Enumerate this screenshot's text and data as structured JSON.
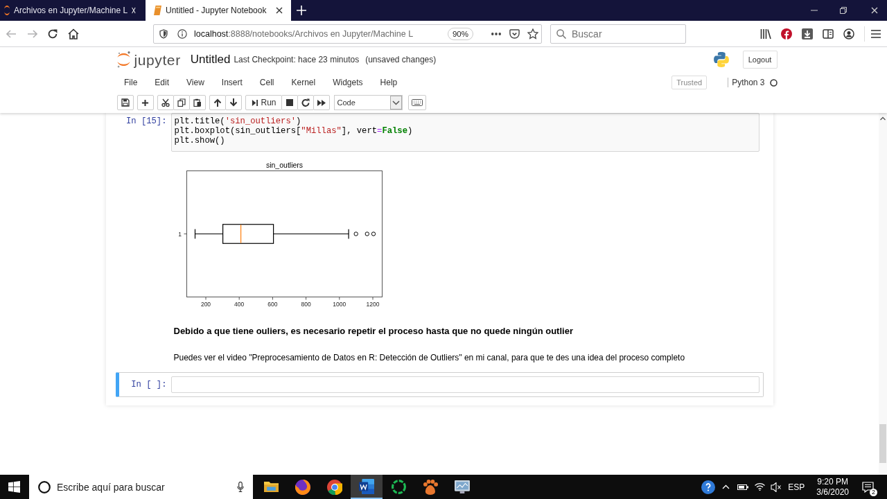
{
  "browser": {
    "tabs": [
      {
        "title": "Archivos en Jupyter/Machine L",
        "kind": "jupyter",
        "selected": false
      },
      {
        "title": "Untitled - Jupyter Notebook",
        "kind": "notebook",
        "selected": true
      }
    ],
    "back": {
      "disabled": true
    },
    "forward": {
      "disabled": true
    },
    "address": {
      "host": "localhost",
      "path": ":8888/notebooks/Archivos en Jupyter/Machine L"
    },
    "zoom": "90%",
    "search": {
      "placeholder": "Buscar"
    }
  },
  "notebook": {
    "logo": "jupyter",
    "name": "Untitled",
    "checkpoint": "Last Checkpoint: hace 23 minutos",
    "save_status": "(unsaved changes)",
    "logout": "Logout",
    "menu": [
      "File",
      "Edit",
      "View",
      "Insert",
      "Cell",
      "Kernel",
      "Widgets",
      "Help"
    ],
    "trusted": "Trusted",
    "kernel": "Python 3",
    "kernel_busy": false,
    "toolbar": {
      "run": "Run",
      "cell_type": "Code"
    }
  },
  "cells": [
    {
      "kind": "code",
      "selected": false,
      "prompt": "In [15]:",
      "lines": [
        [
          {
            "text": "plt.title(",
            "kind": "plain"
          },
          {
            "text": "'sin_outliers'",
            "kind": "string"
          },
          {
            "text": ")",
            "kind": "plain"
          }
        ],
        [
          {
            "text": "plt.boxplot(sin_outliers[",
            "kind": "plain"
          },
          {
            "text": "\"Millas\"",
            "kind": "string"
          },
          {
            "text": "], vert",
            "kind": "plain"
          },
          {
            "text": "=",
            "kind": "operator"
          },
          {
            "text": "False",
            "kind": "keyword"
          },
          {
            "text": ")",
            "kind": "plain"
          }
        ],
        [
          {
            "text": "plt.show()",
            "kind": "plain"
          }
        ]
      ],
      "output": {
        "figure": {
          "title": "sin_outliers",
          "x_tick_labels": [
            "200",
            "400",
            "600",
            "800",
            "1000",
            "1200"
          ],
          "y_tick_labels": [
            "1"
          ]
        }
      }
    },
    {
      "kind": "markdown",
      "selected": false,
      "paragraphs": [
        {
          "text": "Debido a que tiene ouliers, es necesario repetir el proceso hasta que no quede ningún outlier",
          "bold": true
        },
        {
          "text": "Puedes ver el video \"Preprocesamiento de Datos en R: Detección de Outliers\" en mi canal, para que te des una idea del proceso completo",
          "bold": false
        }
      ]
    },
    {
      "kind": "code",
      "selected": true,
      "prompt": "In [ ]:"
    }
  ],
  "taskbar": {
    "search": {
      "placeholder": "Escribe aquí para buscar"
    },
    "apps": [
      {
        "kind": "folder",
        "selected": false
      },
      {
        "kind": "fox",
        "selected": false
      },
      {
        "kind": "segments",
        "selected": false
      },
      {
        "kind": "document",
        "selected": true
      },
      {
        "kind": "ring",
        "selected": false
      },
      {
        "kind": "paw",
        "selected": false
      },
      {
        "kind": "monitor",
        "selected": false
      }
    ],
    "language": "ESP",
    "time": "9:20 PM",
    "date": "3/6/2020",
    "notifications": "2"
  }
}
